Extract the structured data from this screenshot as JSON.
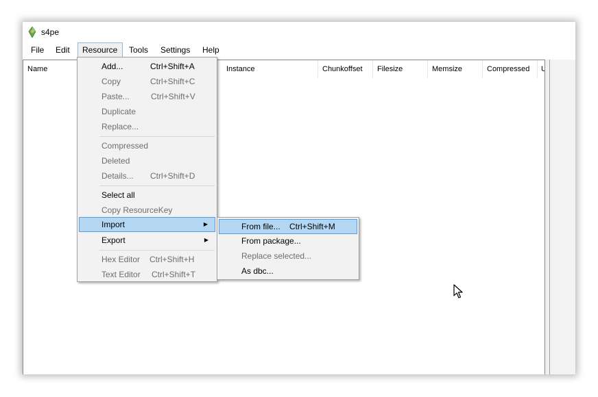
{
  "window": {
    "title": "s4pe"
  },
  "menubar": {
    "items": [
      {
        "label": "File"
      },
      {
        "label": "Edit"
      },
      {
        "label": "Resource"
      },
      {
        "label": "Tools"
      },
      {
        "label": "Settings"
      },
      {
        "label": "Help"
      }
    ]
  },
  "columns": [
    "Name",
    "Instance",
    "Chunkoffset",
    "Filesize",
    "Memsize",
    "Compressed",
    "U"
  ],
  "resource_menu": {
    "items": [
      {
        "label": "Add...",
        "shortcut": "Ctrl+Shift+A",
        "enabled": true
      },
      {
        "label": "Copy",
        "shortcut": "Ctrl+Shift+C",
        "enabled": false
      },
      {
        "label": "Paste...",
        "shortcut": "Ctrl+Shift+V",
        "enabled": false
      },
      {
        "label": "Duplicate",
        "shortcut": "",
        "enabled": false
      },
      {
        "label": "Replace...",
        "shortcut": "",
        "enabled": false
      },
      {
        "label": "Compressed",
        "shortcut": "",
        "enabled": false
      },
      {
        "label": "Deleted",
        "shortcut": "",
        "enabled": false
      },
      {
        "label": "Details...",
        "shortcut": "Ctrl+Shift+D",
        "enabled": false
      },
      {
        "label": "Select all",
        "shortcut": "",
        "enabled": true
      },
      {
        "label": "Copy ResourceKey",
        "shortcut": "",
        "enabled": false
      },
      {
        "label": "Import",
        "shortcut": "",
        "enabled": true,
        "submenu": true,
        "highlighted": true
      },
      {
        "label": "Export",
        "shortcut": "",
        "enabled": true,
        "submenu": true
      },
      {
        "label": "Hex Editor",
        "shortcut": "Ctrl+Shift+H",
        "enabled": false
      },
      {
        "label": "Text Editor",
        "shortcut": "Ctrl+Shift+T",
        "enabled": false
      }
    ]
  },
  "import_submenu": {
    "items": [
      {
        "label": "From file...",
        "shortcut": "Ctrl+Shift+M",
        "enabled": true,
        "highlighted": true
      },
      {
        "label": "From package...",
        "shortcut": "",
        "enabled": true
      },
      {
        "label": "Replace selected...",
        "shortcut": "",
        "enabled": false
      },
      {
        "label": "As dbc...",
        "shortcut": "",
        "enabled": true
      }
    ]
  },
  "icons": {
    "app": "sims-plumbob-icon",
    "submenu_arrow": "submenu-arrow-icon",
    "cursor": "mouse-pointer-icon"
  },
  "colors": {
    "highlight_bg": "#b3d7f3",
    "highlight_border": "#569de5",
    "menu_bg": "#f2f2f2",
    "disabled_text": "#6d6d6d"
  }
}
